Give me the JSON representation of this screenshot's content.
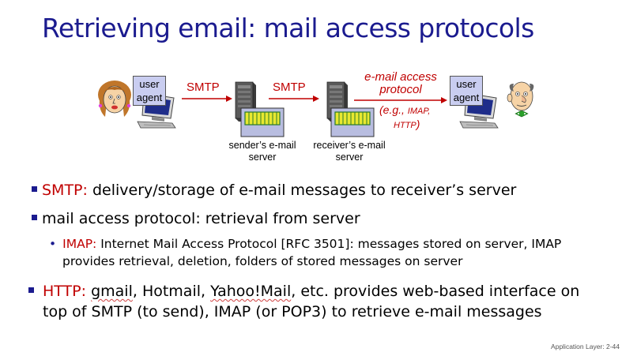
{
  "title": "Retrieving email: mail access protocols",
  "diagram": {
    "left_user_agent": "user agent",
    "right_user_agent": "user agent",
    "smtp_1": "SMTP",
    "smtp_2": "SMTP",
    "access_protocol_line1": "e-mail access",
    "access_protocol_line2": "protocol",
    "eg_line1_prefix": "(e.g., ",
    "eg_line1_imap": "IMAP,",
    "eg_line2": "HTTP",
    "eg_line2_suffix": ")",
    "sender_server_line1": "sender’s e-mail",
    "sender_server_line2": "server",
    "receiver_server_line1": "receiver’s e-mail",
    "receiver_server_line2": "server"
  },
  "bullets": {
    "b1_term": "SMTP:",
    "b1_text": " delivery/storage of e-mail messages to receiver’s server",
    "b2_text": "mail access protocol: retrieval from server",
    "sub_term": "IMAP:",
    "sub_text_line1": " Internet Mail Access Protocol [RFC 3501]: messages stored on server, IMAP",
    "sub_text_line2": "provides retrieval, deletion, folders of stored messages on server",
    "b3_term": "HTTP:",
    "b3_gmail": "gmail",
    "b3_mid1": ", Hotmail, ",
    "b3_yahoo": "Yahoo!Mail",
    "b3_mid2": ", etc. provides web-based interface on",
    "b3_line2": "top of SMTP (to send), IMAP (or POP3) to retrieve e-mail messages"
  },
  "footer": "Application Layer: 2-44",
  "colors": {
    "title": "#1b1b8f",
    "accent_red": "#c00000",
    "bullet": "#1b1b8f",
    "user_agent_box": "#c9cdf0"
  },
  "icons": [
    "woman-face-icon",
    "computer-icon",
    "server-icon",
    "mailbox-icon",
    "man-face-icon"
  ]
}
